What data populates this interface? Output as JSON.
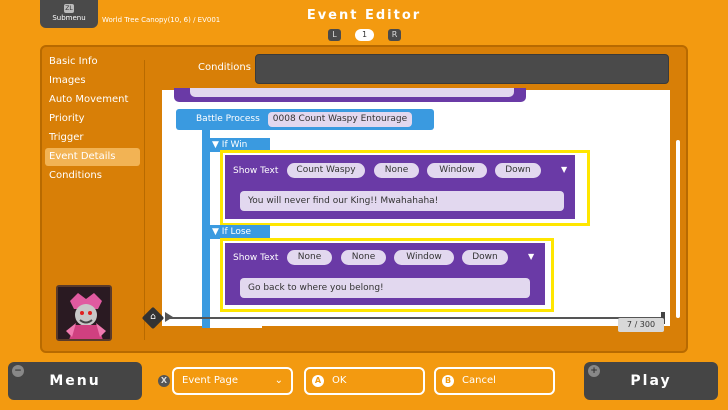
{
  "header": {
    "submenu_key": "ZL",
    "submenu_label": "Submenu",
    "breadcrumb": "World Tree Canopy(10, 6) / EV001",
    "title": "Event Editor",
    "page_left_key": "L",
    "page_number": "1",
    "page_right_key": "R"
  },
  "sidebar": {
    "items": [
      {
        "label": "Basic Info"
      },
      {
        "label": "Images"
      },
      {
        "label": "Auto Movement"
      },
      {
        "label": "Priority"
      },
      {
        "label": "Trigger"
      },
      {
        "label": "Event Details"
      },
      {
        "label": "Conditions"
      }
    ],
    "active_item": "Event Details"
  },
  "conditions": {
    "label": "Conditions",
    "value": ""
  },
  "events": {
    "battle_process": {
      "label": "Battle Process",
      "value": "0008 Count Waspy Entourage"
    },
    "if_win": {
      "label": "If Win",
      "command": "Show Text",
      "speaker": "Count Waspy",
      "face": "None",
      "display": "Window",
      "position": "Down",
      "text": "You will never find our King!! Mwahahaha!"
    },
    "if_lose": {
      "label": "If Lose",
      "command": "Show Text",
      "speaker": "None",
      "face": "None",
      "display": "Window",
      "position": "Down",
      "text": "Go back to where you belong!"
    },
    "counter": "7",
    "counter_total": "/ 300"
  },
  "footer": {
    "menu_label": "Menu",
    "menu_corner": "−",
    "x_key": "X",
    "event_page_label": "Event Page",
    "ok_key": "A",
    "ok_label": "OK",
    "cancel_key": "B",
    "cancel_label": "Cancel",
    "play_label": "Play",
    "play_corner": "+"
  },
  "colors": {
    "background": "#f39a10",
    "panel": "#d87f07",
    "event_block": "#6a3aa6",
    "branch": "#3a9ae0",
    "highlight": "#ffe600"
  },
  "icons": [
    "home-icon",
    "dropdown-caret-icon",
    "play-arrow-icon"
  ]
}
